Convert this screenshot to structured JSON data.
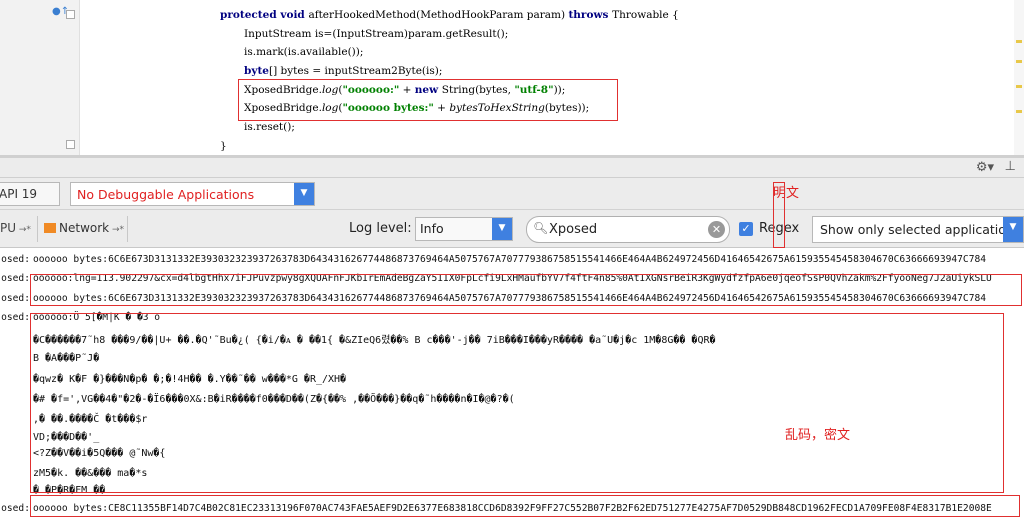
{
  "code": {
    "lines": [
      {
        "parts": [
          [
            "kw",
            "protected "
          ],
          [
            "kw",
            "void "
          ],
          [
            "",
            "afterHookedMethod(MethodHookParam param) "
          ],
          [
            "kw",
            "throws "
          ],
          [
            "",
            "Throwable {"
          ]
        ]
      },
      {
        "parts": [
          [
            "",
            "InputStream is=(InputStream)param.getResult();"
          ]
        ]
      },
      {
        "parts": [
          [
            "",
            "is.mark(is.available());"
          ]
        ]
      },
      {
        "parts": [
          [
            "kw",
            "byte"
          ],
          [
            "",
            "[] bytes = inputStream2Byte(is);"
          ]
        ]
      },
      {
        "parts": [
          [
            "",
            "XposedBridge."
          ],
          [
            "ital",
            "log"
          ],
          [
            "",
            "("
          ],
          [
            "str",
            "\"oooooo:\""
          ],
          [
            "",
            " + "
          ],
          [
            "kw",
            "new "
          ],
          [
            "",
            "String(bytes, "
          ],
          [
            "str",
            "\"utf-8\""
          ],
          [
            "",
            "));"
          ]
        ]
      },
      {
        "parts": [
          [
            "",
            "XposedBridge."
          ],
          [
            "ital",
            "log"
          ],
          [
            "",
            "("
          ],
          [
            "str",
            "\"oooooo bytes:\""
          ],
          [
            "",
            " + "
          ],
          [
            "ital",
            "bytesToHexString"
          ],
          [
            "",
            "(bytes));"
          ]
        ]
      },
      {
        "parts": [
          [
            "",
            "is.reset();"
          ]
        ]
      },
      {
        "parts": [
          [
            "",
            "}"
          ]
        ]
      }
    ]
  },
  "toolbar": {
    "api_label": "API 19",
    "app_combo": "No Debuggable Applications",
    "anno_plain": "明文",
    "tab_cpu": "PU",
    "tab_network": "Network",
    "log_level_label": "Log level:",
    "log_level_value": "Info",
    "search_value": "Xposed",
    "regex_label": "Regex",
    "filter_value": "Show only selected application"
  },
  "log": {
    "anno_cipher": "乱码，密文",
    "lines": [
      {
        "tag": "osed:",
        "msg": "oooooo bytes:6C6E673D3131332E393032323937263783D643431626774486873769464A5075767A707779386758515541466E464A4B624972456D41646542675A615935545458304670C63666693947C784"
      },
      {
        "tag": "osed:",
        "msg": "oooooo:lng=113.902297&cx=d4lbgtHhx7iFJPuvzpwy8gXQUAFnFJKbIrEmAdeBgZaY5IIX0FpLcfi9LxHMaufbYV7f4ftF4n85%0AtIXGNsrBeiR3KgWydfzfpA6e0jqeofSsP0QVhZakm%2FfyooNeg7J2aUiykSLU"
      },
      {
        "tag": "osed:",
        "msg": "oooooo bytes:6C6E673D3131332E393032323937263783D643431626774486873769464A5075767A707779386758515541466E464A4B624972456D41646542675A615935545458304670C63666693947C784"
      },
      {
        "tag": "osed:",
        "msg": "oooooo:Ö 5[�M|K � �3  o"
      },
      {
        "tag": "osed:",
        "msg": "oooooo bytes:CE8C11355BF14D7C4B02C81EC23313196F070AC743FAE5AEF9D2E6377E683818CCD6D8392F9FF27C552B07F2B2F62ED751277E4275AF7D0529DB848CD1962FECD1A709FE08F4E8317B1E2008E"
      }
    ],
    "garbled": [
      "�C������7˜h8 ���9/��|U+ ��.�Q'˜Bu�¿( {�i/�ᴀ    �  ��1{    �&ZIeQ6렸��% B      c���'-j�� 7iB���I���yR����  �a˜U�j�c 1M�8G��  �QR�",
      "B  �A���P˜J�",
      "�qwz� K�F  �}���N�p�  �;�!4H��     �.Y��˜��  w���*G  �R_/XH�",
      "�#  �f=',VG��4�\"�2�-�Ï6���0X&:B�iR����f0���D��(Z�{��% ,��Õ���}��q�˜h����n�I�@�?�(",
      ",�  ��.����Č  �t���$r",
      "VD;���D��'_",
      " <?Z��V��i�5Q���    @˜Nw�{",
      " zM5�k.  ��&���      ma�*s",
      "�  �P�R�FM  ��"
    ]
  }
}
